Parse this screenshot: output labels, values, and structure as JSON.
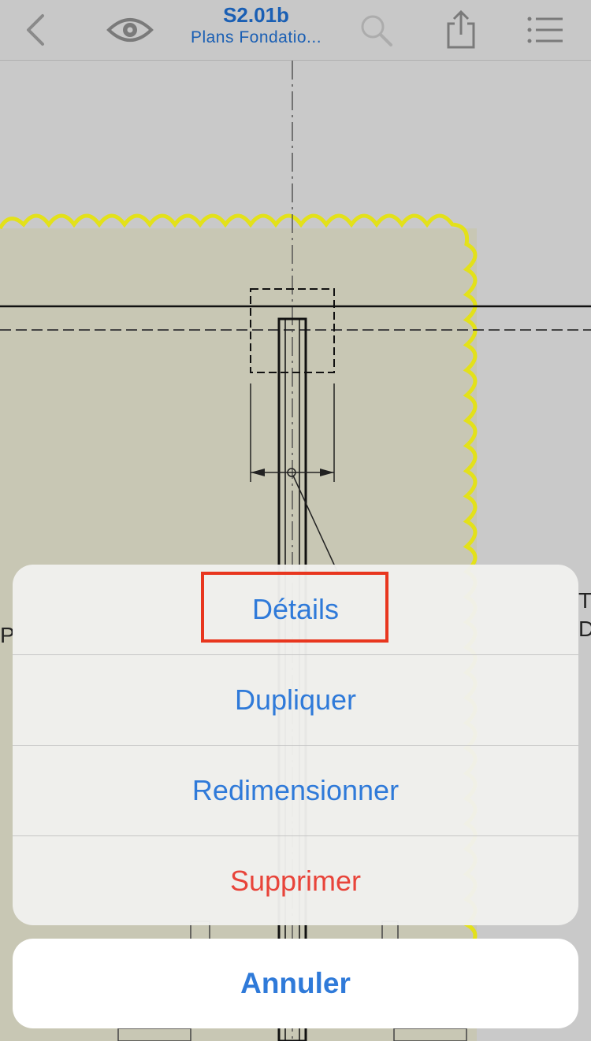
{
  "header": {
    "title": "S2.01b",
    "subtitle": "Plans Fondatio...",
    "icons": [
      "back-chevron-icon",
      "eye-icon",
      "search-icon",
      "share-icon",
      "list-icon"
    ]
  },
  "drawing": {
    "side_text_left": "P",
    "side_text_right_1": "T",
    "side_text_right_2": "D",
    "cloud_color": "#e3e11a"
  },
  "action_sheet": {
    "items": [
      {
        "label": "Détails",
        "highlighted": true
      },
      {
        "label": "Dupliquer"
      },
      {
        "label": "Redimensionner"
      },
      {
        "label": "Supprimer",
        "destructive": true
      }
    ],
    "cancel_label": "Annuler"
  },
  "colors": {
    "accent": "#2f7ad9",
    "destructive": "#e8443a",
    "highlight_box": "#e8361e"
  }
}
